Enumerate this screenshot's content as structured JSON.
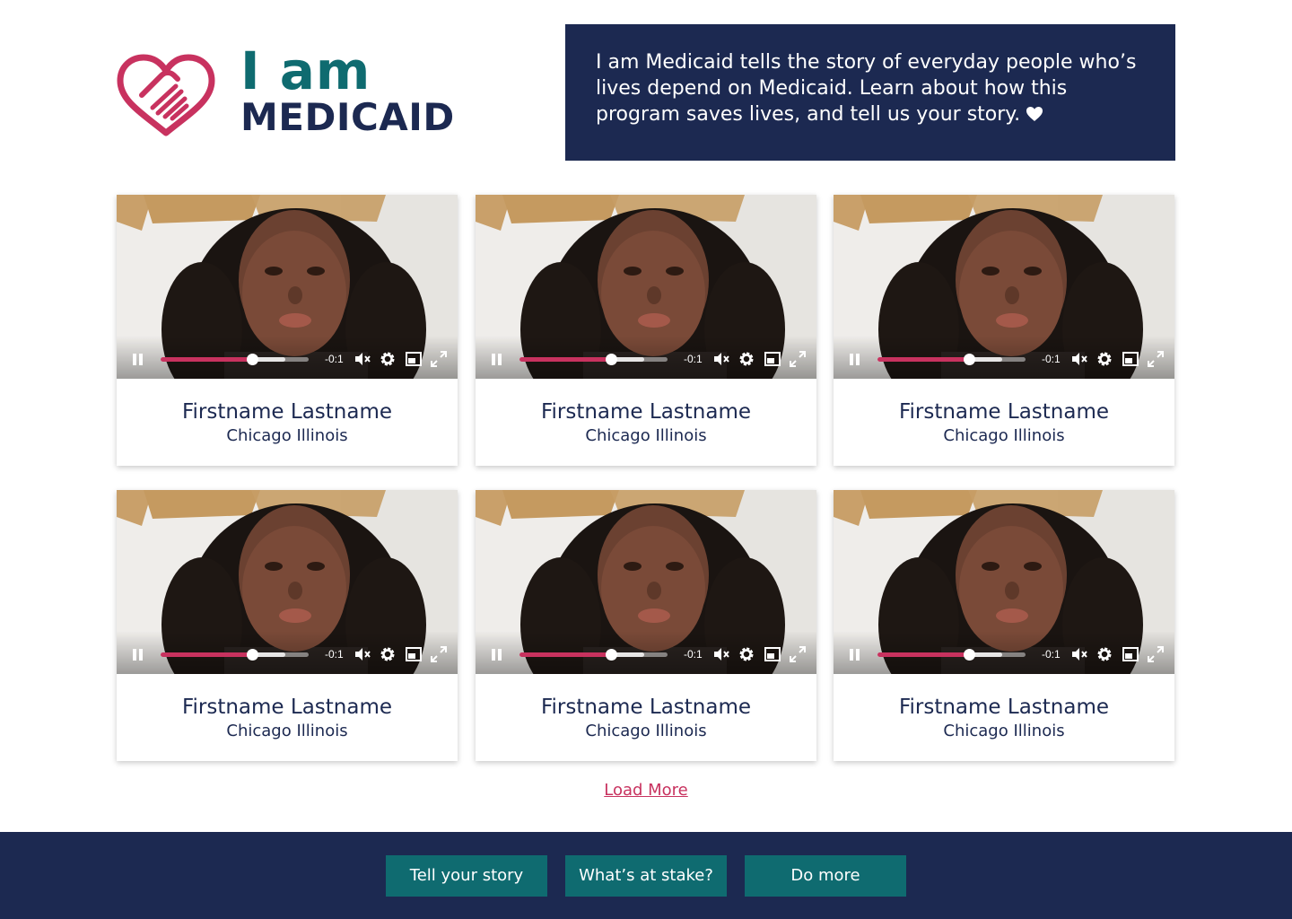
{
  "header": {
    "logo_line1": "I am",
    "logo_line2": "MEDICAID",
    "intro": "I am Medicaid tells the story of everyday people who’s lives depend on Medicaid. Learn about how this program saves lives, and tell us your story.",
    "intro_icon": "heart-icon"
  },
  "colors": {
    "navy": "#1c2951",
    "teal": "#0f6b70",
    "accent": "#c8325f"
  },
  "stories": [
    {
      "name": "Firstname Lastname",
      "location": "Chicago Illinois",
      "time": "-0:1",
      "progress": 0.62,
      "buffered": 0.84
    },
    {
      "name": "Firstname Lastname",
      "location": "Chicago Illinois",
      "time": "-0:1",
      "progress": 0.62,
      "buffered": 0.84
    },
    {
      "name": "Firstname Lastname",
      "location": "Chicago Illinois",
      "time": "-0:1",
      "progress": 0.62,
      "buffered": 0.84
    },
    {
      "name": "Firstname Lastname",
      "location": "Chicago Illinois",
      "time": "-0:1",
      "progress": 0.62,
      "buffered": 0.84
    },
    {
      "name": "Firstname Lastname",
      "location": "Chicago Illinois",
      "time": "-0:1",
      "progress": 0.62,
      "buffered": 0.84
    },
    {
      "name": "Firstname Lastname",
      "location": "Chicago Illinois",
      "time": "-0:1",
      "progress": 0.62,
      "buffered": 0.84
    }
  ],
  "video_controls": [
    "pause-icon",
    "mute-icon",
    "settings-icon",
    "pip-icon",
    "fullscreen-icon"
  ],
  "load_more": "Load More",
  "footer": {
    "tell_story": "Tell your story",
    "whats_at_stake": "What’s at stake?",
    "do_more": "Do more"
  }
}
